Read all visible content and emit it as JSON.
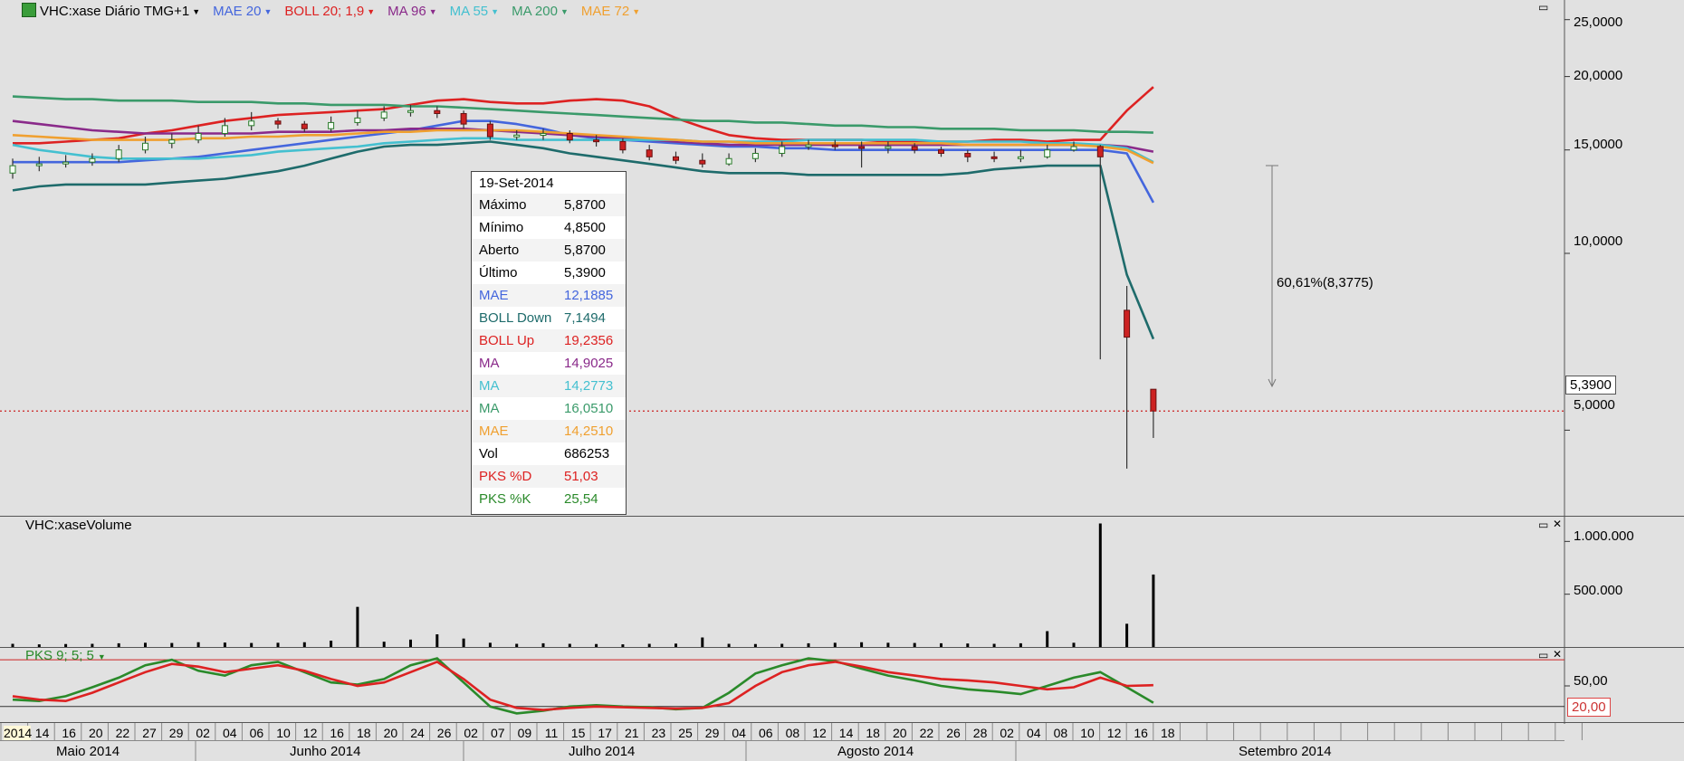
{
  "header": {
    "symbol": "VHC:xase Diário TMG+1",
    "indicators": [
      {
        "label": "MAE 20",
        "color": "#4466dd"
      },
      {
        "label": "BOLL 20; 1,9",
        "color": "#dd2222"
      },
      {
        "label": "MA 96",
        "color": "#8a2a8a"
      },
      {
        "label": "MA 55",
        "color": "#44c0d0"
      },
      {
        "label": "MA 200",
        "color": "#3a9a6a"
      },
      {
        "label": "MAE 72",
        "color": "#f0a030"
      }
    ]
  },
  "price_axis": [
    "25,0000",
    "20,0000",
    "15,0000",
    "10,0000",
    "5,0000"
  ],
  "last_price": "5,3900",
  "measurement": "60,61%(8,3775)",
  "tooltip": {
    "date": "19-Set-2014",
    "rows": [
      {
        "k": "Máximo",
        "v": "5,8700",
        "color": "#000000"
      },
      {
        "k": "Mínimo",
        "v": "4,8500",
        "color": "#000000"
      },
      {
        "k": "Aberto",
        "v": "5,8700",
        "color": "#000000"
      },
      {
        "k": "Último",
        "v": "5,3900",
        "color": "#000000"
      },
      {
        "k": "MAE",
        "v": "12,1885",
        "color": "#4466dd"
      },
      {
        "k": "BOLL Down",
        "v": "7,1494",
        "color": "#1e6b6b"
      },
      {
        "k": "BOLL Up",
        "v": "19,2356",
        "color": "#dd2222"
      },
      {
        "k": "MA",
        "v": "14,9025",
        "color": "#8a2a8a"
      },
      {
        "k": "MA",
        "v": "14,2773",
        "color": "#44c0d0"
      },
      {
        "k": "MA",
        "v": "16,0510",
        "color": "#3a9a6a"
      },
      {
        "k": "MAE",
        "v": "14,2510",
        "color": "#f0a030"
      },
      {
        "k": "Vol",
        "v": "686253",
        "color": "#000000"
      },
      {
        "k": "PKS %D",
        "v": "51,03",
        "color": "#dd2222"
      },
      {
        "k": "PKS %K",
        "v": "25,54",
        "color": "#2a8a2a"
      }
    ]
  },
  "volume_panel": {
    "title": "VHC:xaseVolume",
    "axis": [
      "1.000.000",
      "500.000"
    ]
  },
  "pks_panel": {
    "title": "PKS 9; 5; 5",
    "axis": [
      "50,00"
    ],
    "level": "20,00"
  },
  "date_axis": {
    "days": [
      "2014",
      "14",
      "16",
      "20",
      "22",
      "27",
      "29",
      "02",
      "04",
      "06",
      "10",
      "12",
      "16",
      "18",
      "20",
      "24",
      "26",
      "02",
      "07",
      "09",
      "11",
      "15",
      "17",
      "21",
      "23",
      "25",
      "29",
      "04",
      "06",
      "08",
      "12",
      "14",
      "18",
      "20",
      "22",
      "26",
      "28",
      "02",
      "04",
      "08",
      "10",
      "12",
      "16",
      "18"
    ],
    "months": [
      "Maio 2014",
      "Junho 2014",
      "Julho 2014",
      "Agosto 2014",
      "Setembro 2014"
    ]
  },
  "chart_data": {
    "type": "candlestick",
    "title": "VHC:xase Diário TMG+1",
    "y_scale": "log",
    "ylim": [
      3.6,
      27
    ],
    "series": [
      {
        "name": "MAE 20",
        "values": [
          14.3,
          14.3,
          14.3,
          14.3,
          14.3,
          14.4,
          14.5,
          14.6,
          14.8,
          15.0,
          15.2,
          15.4,
          15.6,
          15.8,
          16.0,
          16.2,
          16.5,
          16.8,
          16.8,
          16.6,
          16.3,
          15.9,
          15.7,
          15.6,
          15.5,
          15.4,
          15.3,
          15.2,
          15.2,
          15.1,
          15.1,
          15.0,
          15.0,
          15.0,
          15.0,
          15.0,
          15.0,
          15.0,
          15.0,
          15.0,
          15.0,
          15.0,
          14.8,
          12.2
        ]
      },
      {
        "name": "BOLL 20; 1,9",
        "values": [
          15.4,
          15.4,
          15.5,
          15.6,
          15.7,
          16.0,
          16.2,
          16.5,
          16.8,
          17.0,
          17.2,
          17.3,
          17.4,
          17.5,
          17.6,
          17.9,
          18.2,
          18.3,
          18.1,
          18.0,
          18.0,
          18.2,
          18.3,
          18.2,
          17.8,
          17.0,
          16.4,
          15.9,
          15.7,
          15.6,
          15.6,
          15.6,
          15.6,
          15.5,
          15.5,
          15.5,
          15.5,
          15.6,
          15.6,
          15.5,
          15.6,
          15.6,
          17.5,
          19.2
        ]
      },
      {
        "name": "MA 96",
        "values": [
          16.8,
          16.6,
          16.4,
          16.2,
          16.1,
          16.0,
          16.0,
          16.0,
          16.0,
          16.0,
          16.1,
          16.1,
          16.1,
          16.2,
          16.2,
          16.3,
          16.3,
          16.3,
          16.2,
          16.1,
          16.0,
          15.9,
          15.8,
          15.7,
          15.6,
          15.5,
          15.4,
          15.3,
          15.3,
          15.3,
          15.3,
          15.3,
          15.3,
          15.3,
          15.3,
          15.3,
          15.3,
          15.3,
          15.3,
          15.3,
          15.3,
          15.3,
          15.2,
          14.9
        ]
      },
      {
        "name": "MA 55",
        "values": [
          15.3,
          15.0,
          14.8,
          14.6,
          14.5,
          14.5,
          14.5,
          14.5,
          14.6,
          14.7,
          14.9,
          15.0,
          15.1,
          15.2,
          15.4,
          15.5,
          15.6,
          15.7,
          15.7,
          15.6,
          15.6,
          15.6,
          15.6,
          15.6,
          15.6,
          15.6,
          15.5,
          15.5,
          15.5,
          15.5,
          15.6,
          15.6,
          15.6,
          15.6,
          15.6,
          15.5,
          15.5,
          15.5,
          15.5,
          15.4,
          15.4,
          15.3,
          15.1,
          14.3
        ]
      },
      {
        "name": "MA 200",
        "values": [
          18.5,
          18.4,
          18.3,
          18.3,
          18.2,
          18.2,
          18.2,
          18.1,
          18.1,
          18.1,
          18.0,
          18.0,
          17.9,
          17.9,
          17.9,
          17.8,
          17.8,
          17.7,
          17.6,
          17.5,
          17.4,
          17.3,
          17.2,
          17.1,
          17.0,
          16.9,
          16.8,
          16.8,
          16.7,
          16.7,
          16.6,
          16.5,
          16.5,
          16.4,
          16.4,
          16.3,
          16.3,
          16.3,
          16.2,
          16.2,
          16.2,
          16.1,
          16.1,
          16.05
        ]
      },
      {
        "name": "MAE 72",
        "values": [
          15.9,
          15.8,
          15.7,
          15.6,
          15.6,
          15.6,
          15.6,
          15.7,
          15.7,
          15.8,
          15.8,
          15.9,
          15.9,
          16.0,
          16.1,
          16.1,
          16.2,
          16.2,
          16.2,
          16.2,
          16.1,
          16.0,
          15.9,
          15.8,
          15.7,
          15.6,
          15.5,
          15.5,
          15.4,
          15.4,
          15.4,
          15.4,
          15.4,
          15.4,
          15.4,
          15.4,
          15.3,
          15.3,
          15.3,
          15.3,
          15.3,
          15.2,
          15.0,
          14.25
        ]
      },
      {
        "name": "BOLL Down",
        "values": [
          12.8,
          13.0,
          13.1,
          13.1,
          13.1,
          13.1,
          13.2,
          13.3,
          13.4,
          13.6,
          13.8,
          14.1,
          14.5,
          14.9,
          15.2,
          15.3,
          15.3,
          15.4,
          15.5,
          15.3,
          15.1,
          14.8,
          14.6,
          14.4,
          14.2,
          14.0,
          13.8,
          13.7,
          13.7,
          13.7,
          13.6,
          13.6,
          13.6,
          13.6,
          13.6,
          13.6,
          13.7,
          13.9,
          14.0,
          14.1,
          14.1,
          14.1,
          9.2,
          7.15
        ]
      }
    ],
    "candles": {
      "open": [
        13.7,
        14.1,
        14.2,
        14.3,
        14.5,
        15.0,
        15.4,
        15.6,
        16.0,
        16.5,
        16.8,
        16.6,
        16.3,
        16.7,
        17.0,
        17.4,
        17.5,
        17.3,
        16.6,
        15.8,
        15.9,
        16.0,
        15.6,
        15.5,
        15.0,
        14.6,
        14.4,
        14.2,
        14.5,
        14.8,
        15.2,
        15.3,
        15.2,
        15.1,
        15.2,
        15.0,
        14.8,
        14.6,
        14.5,
        14.6,
        15.0,
        15.2,
        8.0,
        5.87
      ],
      "close": [
        14.1,
        14.2,
        14.3,
        14.5,
        15.0,
        15.4,
        15.6,
        16.0,
        16.5,
        16.8,
        16.6,
        16.3,
        16.7,
        17.0,
        17.4,
        17.5,
        17.3,
        16.6,
        15.8,
        15.9,
        16.0,
        15.6,
        15.5,
        15.0,
        14.6,
        14.4,
        14.2,
        14.5,
        14.8,
        15.2,
        15.3,
        15.2,
        15.1,
        15.2,
        15.0,
        14.8,
        14.6,
        14.5,
        14.6,
        15.0,
        15.2,
        14.6,
        7.2,
        5.39
      ],
      "high": [
        14.5,
        14.6,
        14.7,
        14.8,
        15.3,
        15.8,
        16.0,
        16.5,
        17.0,
        17.4,
        17.0,
        16.8,
        17.1,
        17.5,
        17.8,
        17.9,
        17.8,
        17.5,
        16.8,
        16.2,
        16.3,
        16.2,
        15.9,
        15.7,
        15.3,
        14.9,
        14.8,
        14.8,
        15.1,
        15.5,
        15.6,
        15.6,
        15.5,
        15.5,
        15.4,
        15.2,
        15.0,
        14.9,
        15.0,
        15.3,
        15.5,
        15.3,
        8.8,
        5.87
      ],
      "low": [
        13.4,
        13.8,
        14.0,
        14.1,
        14.3,
        14.8,
        15.1,
        15.4,
        15.8,
        16.2,
        16.3,
        16.1,
        16.1,
        16.5,
        16.8,
        17.1,
        17.0,
        16.3,
        15.6,
        15.6,
        15.6,
        15.4,
        15.2,
        14.8,
        14.4,
        14.2,
        14.0,
        14.1,
        14.3,
        14.6,
        15.0,
        15.0,
        14.0,
        14.8,
        14.8,
        14.6,
        14.3,
        14.3,
        14.3,
        14.5,
        14.9,
        6.6,
        4.3,
        4.85
      ]
    },
    "volume": [
      30000,
      25000,
      28000,
      30000,
      35000,
      40000,
      38000,
      45000,
      42000,
      38000,
      40000,
      45000,
      60000,
      380000,
      50000,
      70000,
      120000,
      80000,
      40000,
      30000,
      35000,
      30000,
      28000,
      25000,
      30000,
      32000,
      90000,
      30000,
      28000,
      30000,
      35000,
      40000,
      45000,
      40000,
      38000,
      35000,
      33000,
      30000,
      35000,
      150000,
      40000,
      1170000,
      220000,
      686253
    ],
    "pks_d": [
      35,
      30,
      28,
      40,
      55,
      70,
      82,
      78,
      70,
      75,
      80,
      72,
      60,
      50,
      55,
      70,
      85,
      60,
      30,
      18,
      15,
      18,
      20,
      19,
      18,
      17,
      18,
      25,
      50,
      70,
      80,
      85,
      78,
      70,
      65,
      60,
      58,
      55,
      50,
      45,
      48,
      62,
      50,
      51.03
    ],
    "pks_k": [
      30,
      28,
      35,
      48,
      62,
      80,
      88,
      72,
      65,
      80,
      85,
      70,
      55,
      52,
      60,
      80,
      90,
      55,
      20,
      10,
      14,
      20,
      22,
      20,
      19,
      16,
      18,
      40,
      68,
      80,
      90,
      86,
      75,
      65,
      58,
      50,
      45,
      42,
      38,
      50,
      62,
      70,
      48,
      25.54
    ]
  }
}
